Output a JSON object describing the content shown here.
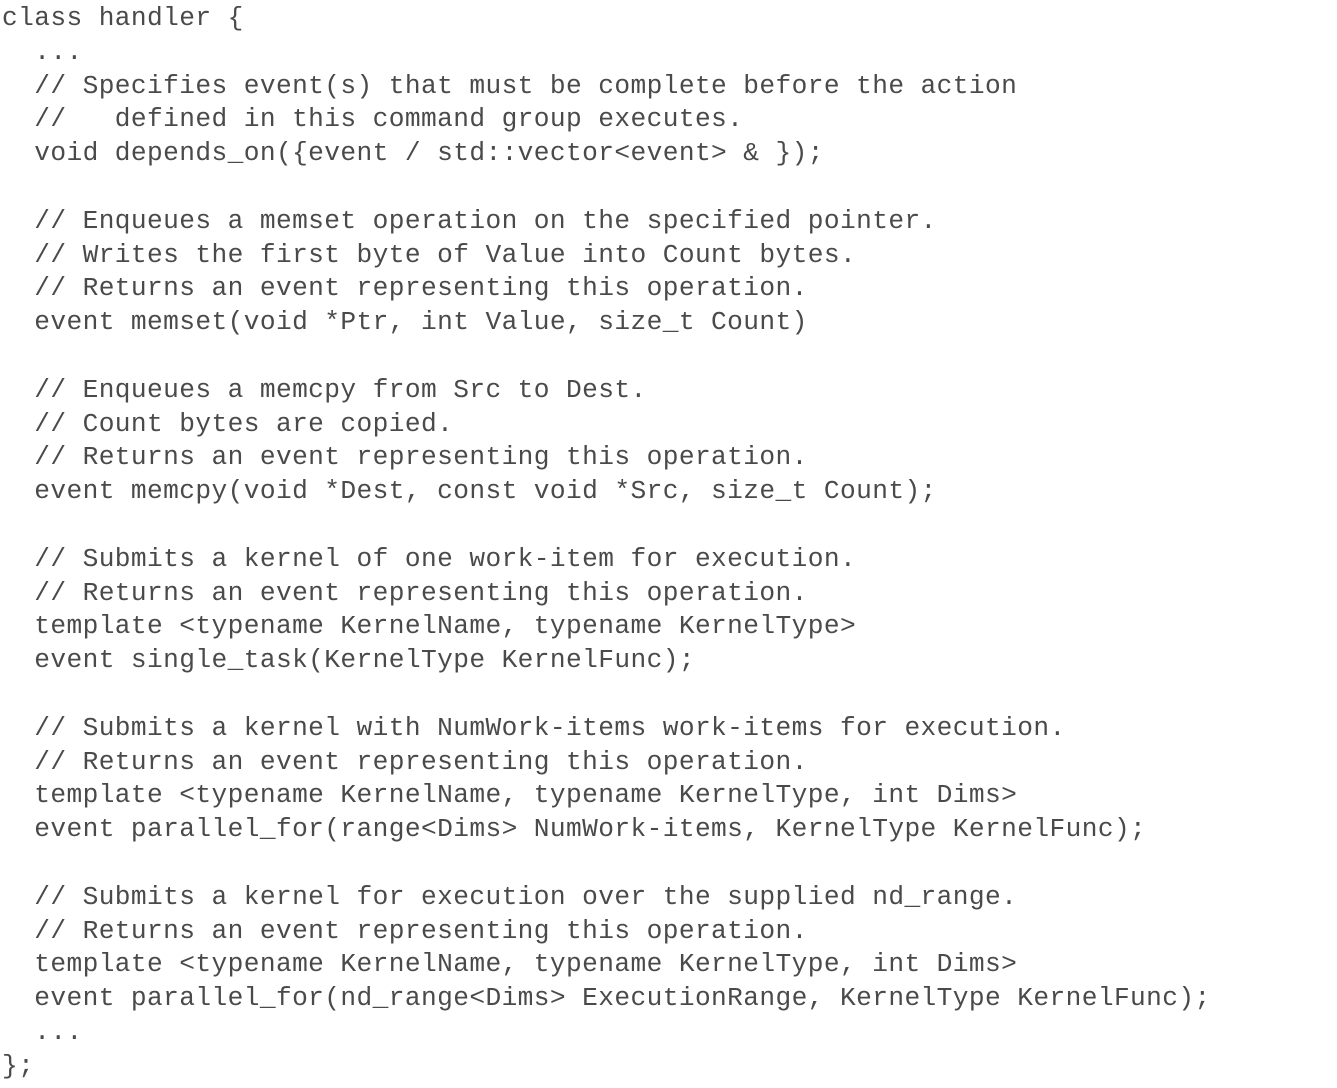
{
  "listing": {
    "lines": [
      "class handler {",
      "  ...",
      "  // Specifies event(s) that must be complete before the action",
      "  //   defined in this command group executes.",
      "  void depends_on({event / std::vector<event> & });",
      "",
      "  // Enqueues a memset operation on the specified pointer.",
      "  // Writes the first byte of Value into Count bytes.",
      "  // Returns an event representing this operation.",
      "  event memset(void *Ptr, int Value, size_t Count)",
      "",
      "  // Enqueues a memcpy from Src to Dest.",
      "  // Count bytes are copied.",
      "  // Returns an event representing this operation.",
      "  event memcpy(void *Dest, const void *Src, size_t Count);",
      "",
      "  // Submits a kernel of one work-item for execution.",
      "  // Returns an event representing this operation.",
      "  template <typename KernelName, typename KernelType>",
      "  event single_task(KernelType KernelFunc);",
      "",
      "  // Submits a kernel with NumWork-items work-items for execution.",
      "  // Returns an event representing this operation.",
      "  template <typename KernelName, typename KernelType, int Dims>",
      "  event parallel_for(range<Dims> NumWork-items, KernelType KernelFunc);",
      "",
      "  // Submits a kernel for execution over the supplied nd_range.",
      "  // Returns an event representing this operation.",
      "  template <typename KernelName, typename KernelType, int Dims>",
      "  event parallel_for(nd_range<Dims> ExecutionRange, KernelType KernelFunc);",
      "  ...",
      "};"
    ]
  }
}
